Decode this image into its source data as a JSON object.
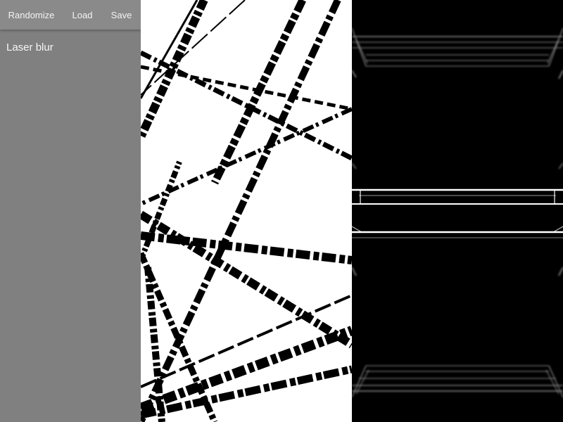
{
  "toolbar": {
    "randomize_label": "Randomize",
    "load_label": "Load",
    "save_label": "Save"
  },
  "preset": {
    "name": "Laser blur"
  },
  "colors": {
    "panel_bg": "#808080",
    "toolbar_bg": "#8a8a8a",
    "text": "#f4f4f4",
    "source_bg": "#ffffff",
    "line_color": "#000000",
    "output_bg": "#000000",
    "glow_color": "#ffffff"
  }
}
